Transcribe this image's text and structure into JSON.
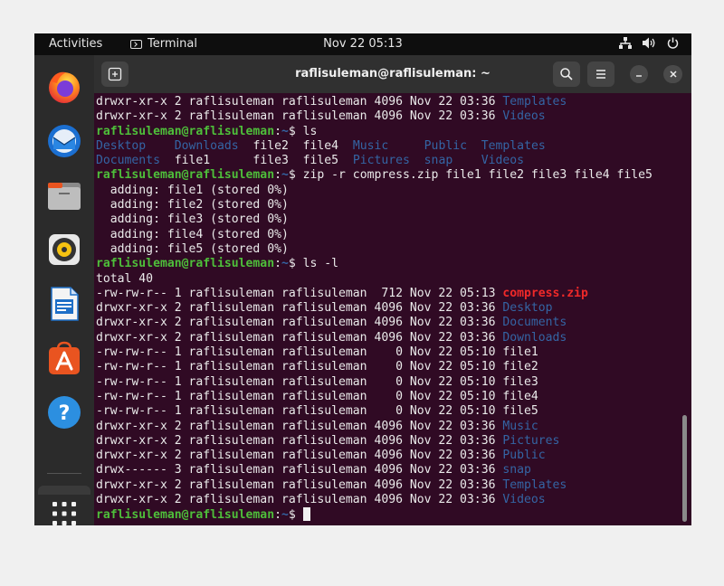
{
  "topbar": {
    "activities": "Activities",
    "app_name": "Terminal",
    "clock": "Nov 22  05:13"
  },
  "dock": {
    "items": [
      {
        "name": "firefox-icon",
        "label": "Firefox"
      },
      {
        "name": "thunderbird-icon",
        "label": "Thunderbird"
      },
      {
        "name": "files-icon",
        "label": "Files"
      },
      {
        "name": "rhythmbox-icon",
        "label": "Rhythmbox"
      },
      {
        "name": "libreoffice-writer-icon",
        "label": "LibreOffice Writer"
      },
      {
        "name": "app-center-icon",
        "label": "Ubuntu Software"
      },
      {
        "name": "help-icon",
        "label": "Help"
      },
      {
        "name": "show-apps-icon",
        "label": "Show Applications"
      }
    ]
  },
  "window": {
    "title": "raflisuleman@raflisuleman: ~",
    "buttons": [
      "new-tab",
      "search",
      "menu",
      "minimize",
      "maximize",
      "close"
    ]
  },
  "terminal": {
    "colors": {
      "background": "#300a24",
      "prompt_user": "#4ebf3a",
      "prompt_path": "#3465a4",
      "directory": "#3465a4",
      "archive": "#ef2929",
      "text": "#eaeaea"
    },
    "lines": [
      [
        {
          "t": "drwxr-xr-x 2 raflisuleman raflisuleman 4096 Nov 22 03:36 ",
          "c": "txt"
        },
        {
          "t": "Templates",
          "c": "dir"
        }
      ],
      [
        {
          "t": "drwxr-xr-x 2 raflisuleman raflisuleman 4096 Nov 22 03:36 ",
          "c": "txt"
        },
        {
          "t": "Videos",
          "c": "dir"
        }
      ],
      [
        {
          "t": "raflisuleman@raflisuleman",
          "c": "user"
        },
        {
          "t": ":",
          "c": "txt"
        },
        {
          "t": "~",
          "c": "path"
        },
        {
          "t": "$ ls",
          "c": "txt"
        }
      ],
      [
        {
          "t": "Desktop",
          "c": "dir"
        },
        {
          "t": "    ",
          "c": "txt"
        },
        {
          "t": "Downloads",
          "c": "dir"
        },
        {
          "t": "  file2  file4  ",
          "c": "txt"
        },
        {
          "t": "Music",
          "c": "dir"
        },
        {
          "t": "     ",
          "c": "txt"
        },
        {
          "t": "Public",
          "c": "dir"
        },
        {
          "t": "  ",
          "c": "txt"
        },
        {
          "t": "Templates",
          "c": "dir"
        }
      ],
      [
        {
          "t": "Documents",
          "c": "dir"
        },
        {
          "t": "  file1      file3  file5  ",
          "c": "txt"
        },
        {
          "t": "Pictures",
          "c": "dir"
        },
        {
          "t": "  ",
          "c": "txt"
        },
        {
          "t": "snap",
          "c": "dir"
        },
        {
          "t": "    ",
          "c": "txt"
        },
        {
          "t": "Videos",
          "c": "dir"
        }
      ],
      [
        {
          "t": "raflisuleman@raflisuleman",
          "c": "user"
        },
        {
          "t": ":",
          "c": "txt"
        },
        {
          "t": "~",
          "c": "path"
        },
        {
          "t": "$ zip -r compress.zip file1 file2 file3 file4 file5",
          "c": "txt"
        }
      ],
      [
        {
          "t": "  adding: file1 (stored 0%)",
          "c": "txt"
        }
      ],
      [
        {
          "t": "  adding: file2 (stored 0%)",
          "c": "txt"
        }
      ],
      [
        {
          "t": "  adding: file3 (stored 0%)",
          "c": "txt"
        }
      ],
      [
        {
          "t": "  adding: file4 (stored 0%)",
          "c": "txt"
        }
      ],
      [
        {
          "t": "  adding: file5 (stored 0%)",
          "c": "txt"
        }
      ],
      [
        {
          "t": "raflisuleman@raflisuleman",
          "c": "user"
        },
        {
          "t": ":",
          "c": "txt"
        },
        {
          "t": "~",
          "c": "path"
        },
        {
          "t": "$ ls -l",
          "c": "txt"
        }
      ],
      [
        {
          "t": "total 40",
          "c": "txt"
        }
      ],
      [
        {
          "t": "-rw-rw-r-- 1 raflisuleman raflisuleman  712 Nov 22 05:13 ",
          "c": "txt"
        },
        {
          "t": "compress.zip",
          "c": "zip"
        }
      ],
      [
        {
          "t": "drwxr-xr-x 2 raflisuleman raflisuleman 4096 Nov 22 03:36 ",
          "c": "txt"
        },
        {
          "t": "Desktop",
          "c": "dir"
        }
      ],
      [
        {
          "t": "drwxr-xr-x 2 raflisuleman raflisuleman 4096 Nov 22 03:36 ",
          "c": "txt"
        },
        {
          "t": "Documents",
          "c": "dir"
        }
      ],
      [
        {
          "t": "drwxr-xr-x 2 raflisuleman raflisuleman 4096 Nov 22 03:36 ",
          "c": "txt"
        },
        {
          "t": "Downloads",
          "c": "dir"
        }
      ],
      [
        {
          "t": "-rw-rw-r-- 1 raflisuleman raflisuleman    0 Nov 22 05:10 file1",
          "c": "txt"
        }
      ],
      [
        {
          "t": "-rw-rw-r-- 1 raflisuleman raflisuleman    0 Nov 22 05:10 file2",
          "c": "txt"
        }
      ],
      [
        {
          "t": "-rw-rw-r-- 1 raflisuleman raflisuleman    0 Nov 22 05:10 file3",
          "c": "txt"
        }
      ],
      [
        {
          "t": "-rw-rw-r-- 1 raflisuleman raflisuleman    0 Nov 22 05:10 file4",
          "c": "txt"
        }
      ],
      [
        {
          "t": "-rw-rw-r-- 1 raflisuleman raflisuleman    0 Nov 22 05:10 file5",
          "c": "txt"
        }
      ],
      [
        {
          "t": "drwxr-xr-x 2 raflisuleman raflisuleman 4096 Nov 22 03:36 ",
          "c": "txt"
        },
        {
          "t": "Music",
          "c": "dir"
        }
      ],
      [
        {
          "t": "drwxr-xr-x 2 raflisuleman raflisuleman 4096 Nov 22 03:36 ",
          "c": "txt"
        },
        {
          "t": "Pictures",
          "c": "dir"
        }
      ],
      [
        {
          "t": "drwxr-xr-x 2 raflisuleman raflisuleman 4096 Nov 22 03:36 ",
          "c": "txt"
        },
        {
          "t": "Public",
          "c": "dir"
        }
      ],
      [
        {
          "t": "drwx------ 3 raflisuleman raflisuleman 4096 Nov 22 03:36 ",
          "c": "txt"
        },
        {
          "t": "snap",
          "c": "dir"
        }
      ],
      [
        {
          "t": "drwxr-xr-x 2 raflisuleman raflisuleman 4096 Nov 22 03:36 ",
          "c": "txt"
        },
        {
          "t": "Templates",
          "c": "dir"
        }
      ],
      [
        {
          "t": "drwxr-xr-x 2 raflisuleman raflisuleman 4096 Nov 22 03:36 ",
          "c": "txt"
        },
        {
          "t": "Videos",
          "c": "dir"
        }
      ]
    ],
    "prompt": [
      {
        "t": "raflisuleman@raflisuleman",
        "c": "user"
      },
      {
        "t": ":",
        "c": "txt"
      },
      {
        "t": "~",
        "c": "path"
      },
      {
        "t": "$ ",
        "c": "txt"
      }
    ]
  }
}
